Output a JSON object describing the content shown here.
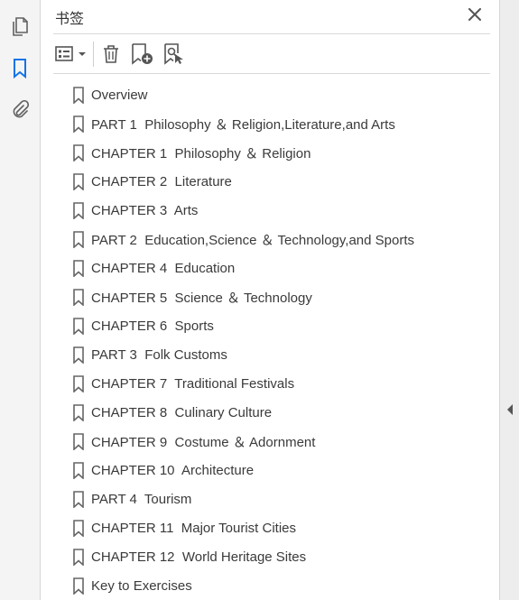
{
  "rail": {
    "icons": [
      "pages-icon",
      "bookmark-icon",
      "attachment-icon"
    ]
  },
  "panel": {
    "title": "书签",
    "close_icon": "close-icon"
  },
  "toolbar": {
    "buttons": [
      "options-menu-icon",
      "delete-bookmark-icon",
      "new-bookmark-icon",
      "find-bookmark-icon"
    ]
  },
  "bookmarks": [
    {
      "label": "Overview"
    },
    {
      "label": "PART 1  Philosophy ＆ Religion,Literature,and Arts"
    },
    {
      "label": "CHAPTER 1  Philosophy ＆ Religion"
    },
    {
      "label": "CHAPTER 2  Literature"
    },
    {
      "label": "CHAPTER 3  Arts"
    },
    {
      "label": "PART 2  Education,Science ＆ Technology,and Sports"
    },
    {
      "label": "CHAPTER 4  Education"
    },
    {
      "label": "CHAPTER 5  Science ＆ Technology"
    },
    {
      "label": "CHAPTER 6  Sports"
    },
    {
      "label": "PART 3  Folk Customs"
    },
    {
      "label": "CHAPTER 7  Traditional Festivals"
    },
    {
      "label": "CHAPTER 8  Culinary Culture"
    },
    {
      "label": "CHAPTER 9  Costume ＆ Adornment"
    },
    {
      "label": "CHAPTER 10  Architecture"
    },
    {
      "label": "PART 4  Tourism"
    },
    {
      "label": "CHAPTER 11  Major Tourist Cities"
    },
    {
      "label": "CHAPTER 12  World Heritage Sites"
    },
    {
      "label": "Key to Exercises"
    }
  ],
  "colors": {
    "accent": "#1473e6",
    "icon_gray": "#616161"
  }
}
